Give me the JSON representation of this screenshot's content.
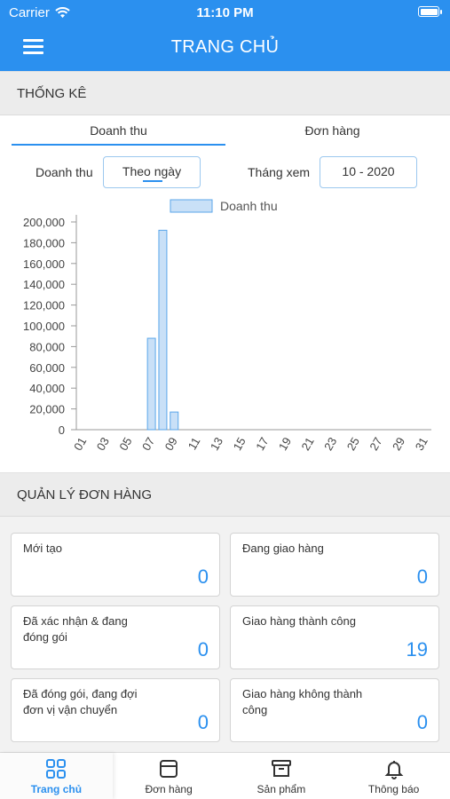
{
  "status_bar": {
    "carrier": "Carrier",
    "time": "11:10 PM"
  },
  "header": {
    "title": "TRANG CHỦ"
  },
  "stats_section": {
    "title": "THỐNG KÊ"
  },
  "tabs": [
    {
      "label": "Doanh thu",
      "active": true
    },
    {
      "label": "Đơn hàng",
      "active": false
    }
  ],
  "filters": {
    "revenue_label": "Doanh thu",
    "period_value": "Theo ngày",
    "month_label": "Tháng xem",
    "month_value": "10 - 2020"
  },
  "chart_data": {
    "type": "bar",
    "legend": "Doanh thu",
    "categories": [
      "01",
      "02",
      "03",
      "04",
      "05",
      "06",
      "07",
      "08",
      "09",
      "10",
      "11",
      "12",
      "13",
      "14",
      "15",
      "16",
      "17",
      "18",
      "19",
      "20",
      "21",
      "22",
      "23",
      "24",
      "25",
      "26",
      "27",
      "28",
      "29",
      "30",
      "31"
    ],
    "tick_labels": [
      "01",
      "03",
      "05",
      "07",
      "09",
      "11",
      "13",
      "15",
      "17",
      "19",
      "21",
      "23",
      "25",
      "27",
      "29",
      "31"
    ],
    "values": [
      0,
      0,
      0,
      0,
      0,
      0,
      88000,
      192000,
      17000,
      0,
      0,
      0,
      0,
      0,
      0,
      0,
      0,
      0,
      0,
      0,
      0,
      0,
      0,
      0,
      0,
      0,
      0,
      0,
      0,
      0,
      0
    ],
    "ylim": [
      0,
      200000
    ],
    "yticks": [
      "0",
      "20,000",
      "40,000",
      "60,000",
      "80,000",
      "100,000",
      "120,000",
      "140,000",
      "160,000",
      "180,000",
      "200,000"
    ],
    "bar_color": "#c9e0f7",
    "bar_border": "#5aa6ea"
  },
  "orders_section": {
    "title": "QUẢN LÝ ĐƠN HÀNG"
  },
  "order_cards": [
    {
      "label": "Mới tạo",
      "value": "0"
    },
    {
      "label": "Đang giao hàng",
      "value": "0"
    },
    {
      "label": "Đã xác nhận & đang đóng gói",
      "value": "0"
    },
    {
      "label": "Giao hàng thành công",
      "value": "19"
    },
    {
      "label": "Đã đóng gói, đang đợi đơn vị vận chuyển",
      "value": "0"
    },
    {
      "label": "Giao hàng không thành công",
      "value": "0"
    }
  ],
  "tabbar": [
    {
      "label": "Trang chủ",
      "icon": "grid-icon",
      "active": true
    },
    {
      "label": "Đơn hàng",
      "icon": "order-icon",
      "active": false
    },
    {
      "label": "Sản phẩm",
      "icon": "archive-icon",
      "active": false
    },
    {
      "label": "Thông báo",
      "icon": "bell-icon",
      "active": false
    }
  ],
  "colors": {
    "accent": "#2b90ef"
  }
}
